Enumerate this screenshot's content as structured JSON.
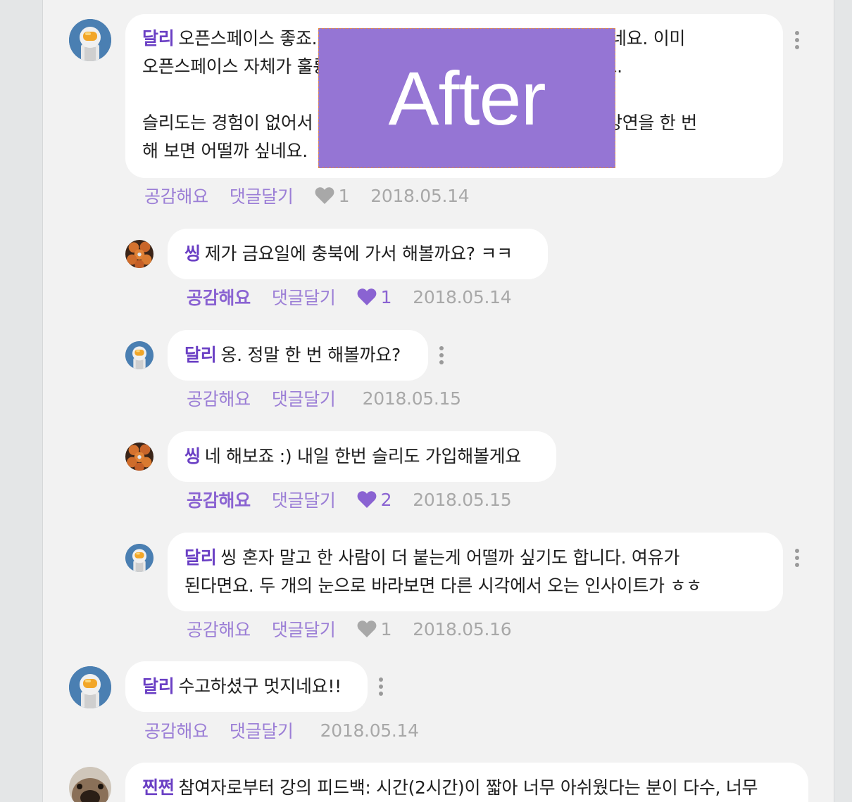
{
  "accent_color": "#6a3fc4",
  "icons": {
    "more": "kebab-icon",
    "like": "heart-icon"
  },
  "overlay_label": "After",
  "comments": [
    {
      "author": "달리",
      "text_line1": "오픈스페이스 좋죠. 남들 앞에서 이야기할 수 있는 좋은 기회네요. 이미",
      "text_line2": "오픈스페이스 자체가 훌륭한 경험이니 한 번 더 해보셔도 좋겠어요.",
      "text_line3": "",
      "text_line4": "슬리도는 경험이 없어서 잘 모르겠지만 다음 번에는 작은 강의나 강연을 한 번",
      "text_line5": "해 보면 어떨까 싶네요.",
      "empathize": "공감해요",
      "reply": "댓글달기",
      "likes": "1",
      "date": "2018.05.14"
    },
    {
      "author": "씽",
      "text": "제가 금요일에 충북에 가서 해볼까요? ㅋㅋ",
      "empathize": "공감해요",
      "reply": "댓글달기",
      "likes": "1",
      "date": "2018.05.14"
    },
    {
      "author": "달리",
      "text": "옹. 정말 한 번 해볼까요?",
      "empathize": "공감해요",
      "reply": "댓글달기",
      "date": "2018.05.15"
    },
    {
      "author": "씽",
      "text": "네 해보죠 :) 내일 한번 슬리도 가입해볼게요",
      "empathize": "공감해요",
      "reply": "댓글달기",
      "likes": "2",
      "date": "2018.05.15"
    },
    {
      "author": "달리",
      "text_line1": "씽 혼자 말고 한 사람이 더 붙는게 어떨까 싶기도 합니다. 여유가",
      "text_line2": "된다면요. 두 개의 눈으로 바라보면 다른 시각에서 오는 인사이트가 ㅎㅎ",
      "empathize": "공감해요",
      "reply": "댓글달기",
      "likes": "1",
      "date": "2018.05.16"
    },
    {
      "author": "달리",
      "text": "수고하셨구 멋지네요!!",
      "empathize": "공감해요",
      "reply": "댓글달기",
      "date": "2018.05.14"
    },
    {
      "author": "찐쩐",
      "text": "참여자로부터 강의 피드백: 시간(2시간)이 짧아 너무 아쉬웠다는 분이 다수, 너무"
    }
  ]
}
